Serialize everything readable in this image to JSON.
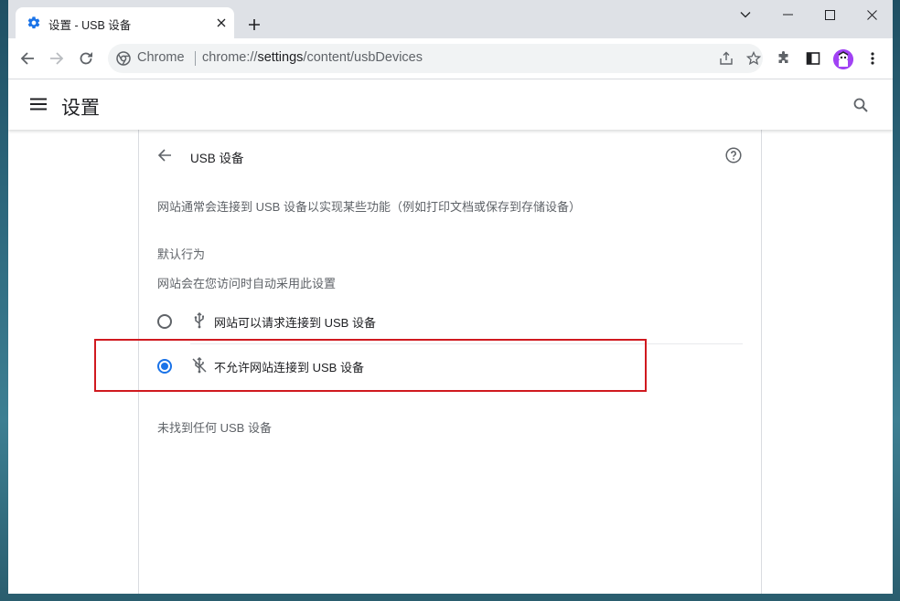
{
  "browser": {
    "tab": {
      "title": "设置 - USB 设备"
    },
    "omnibox": {
      "chip_label": "Chrome",
      "url_prefix": "chrome://",
      "url_host": "settings",
      "url_path": "/content/usbDevices"
    }
  },
  "header": {
    "title": "设置"
  },
  "page": {
    "title": "USB 设备",
    "description": "网站通常会连接到 USB 设备以实现某些功能（例如打印文档或保存到存储设备）",
    "default_behavior": {
      "heading": "默认行为",
      "subheading": "网站会在您访问时自动采用此设置",
      "options": [
        {
          "label": "网站可以请求连接到 USB 设备",
          "icon": "usb-icon",
          "selected": false
        },
        {
          "label": "不允许网站连接到 USB 设备",
          "icon": "usb-off-icon",
          "selected": true
        }
      ]
    },
    "empty_message": "未找到任何 USB 设备"
  },
  "colors": {
    "accent": "#1a73e8",
    "highlight": "#d0191f"
  }
}
